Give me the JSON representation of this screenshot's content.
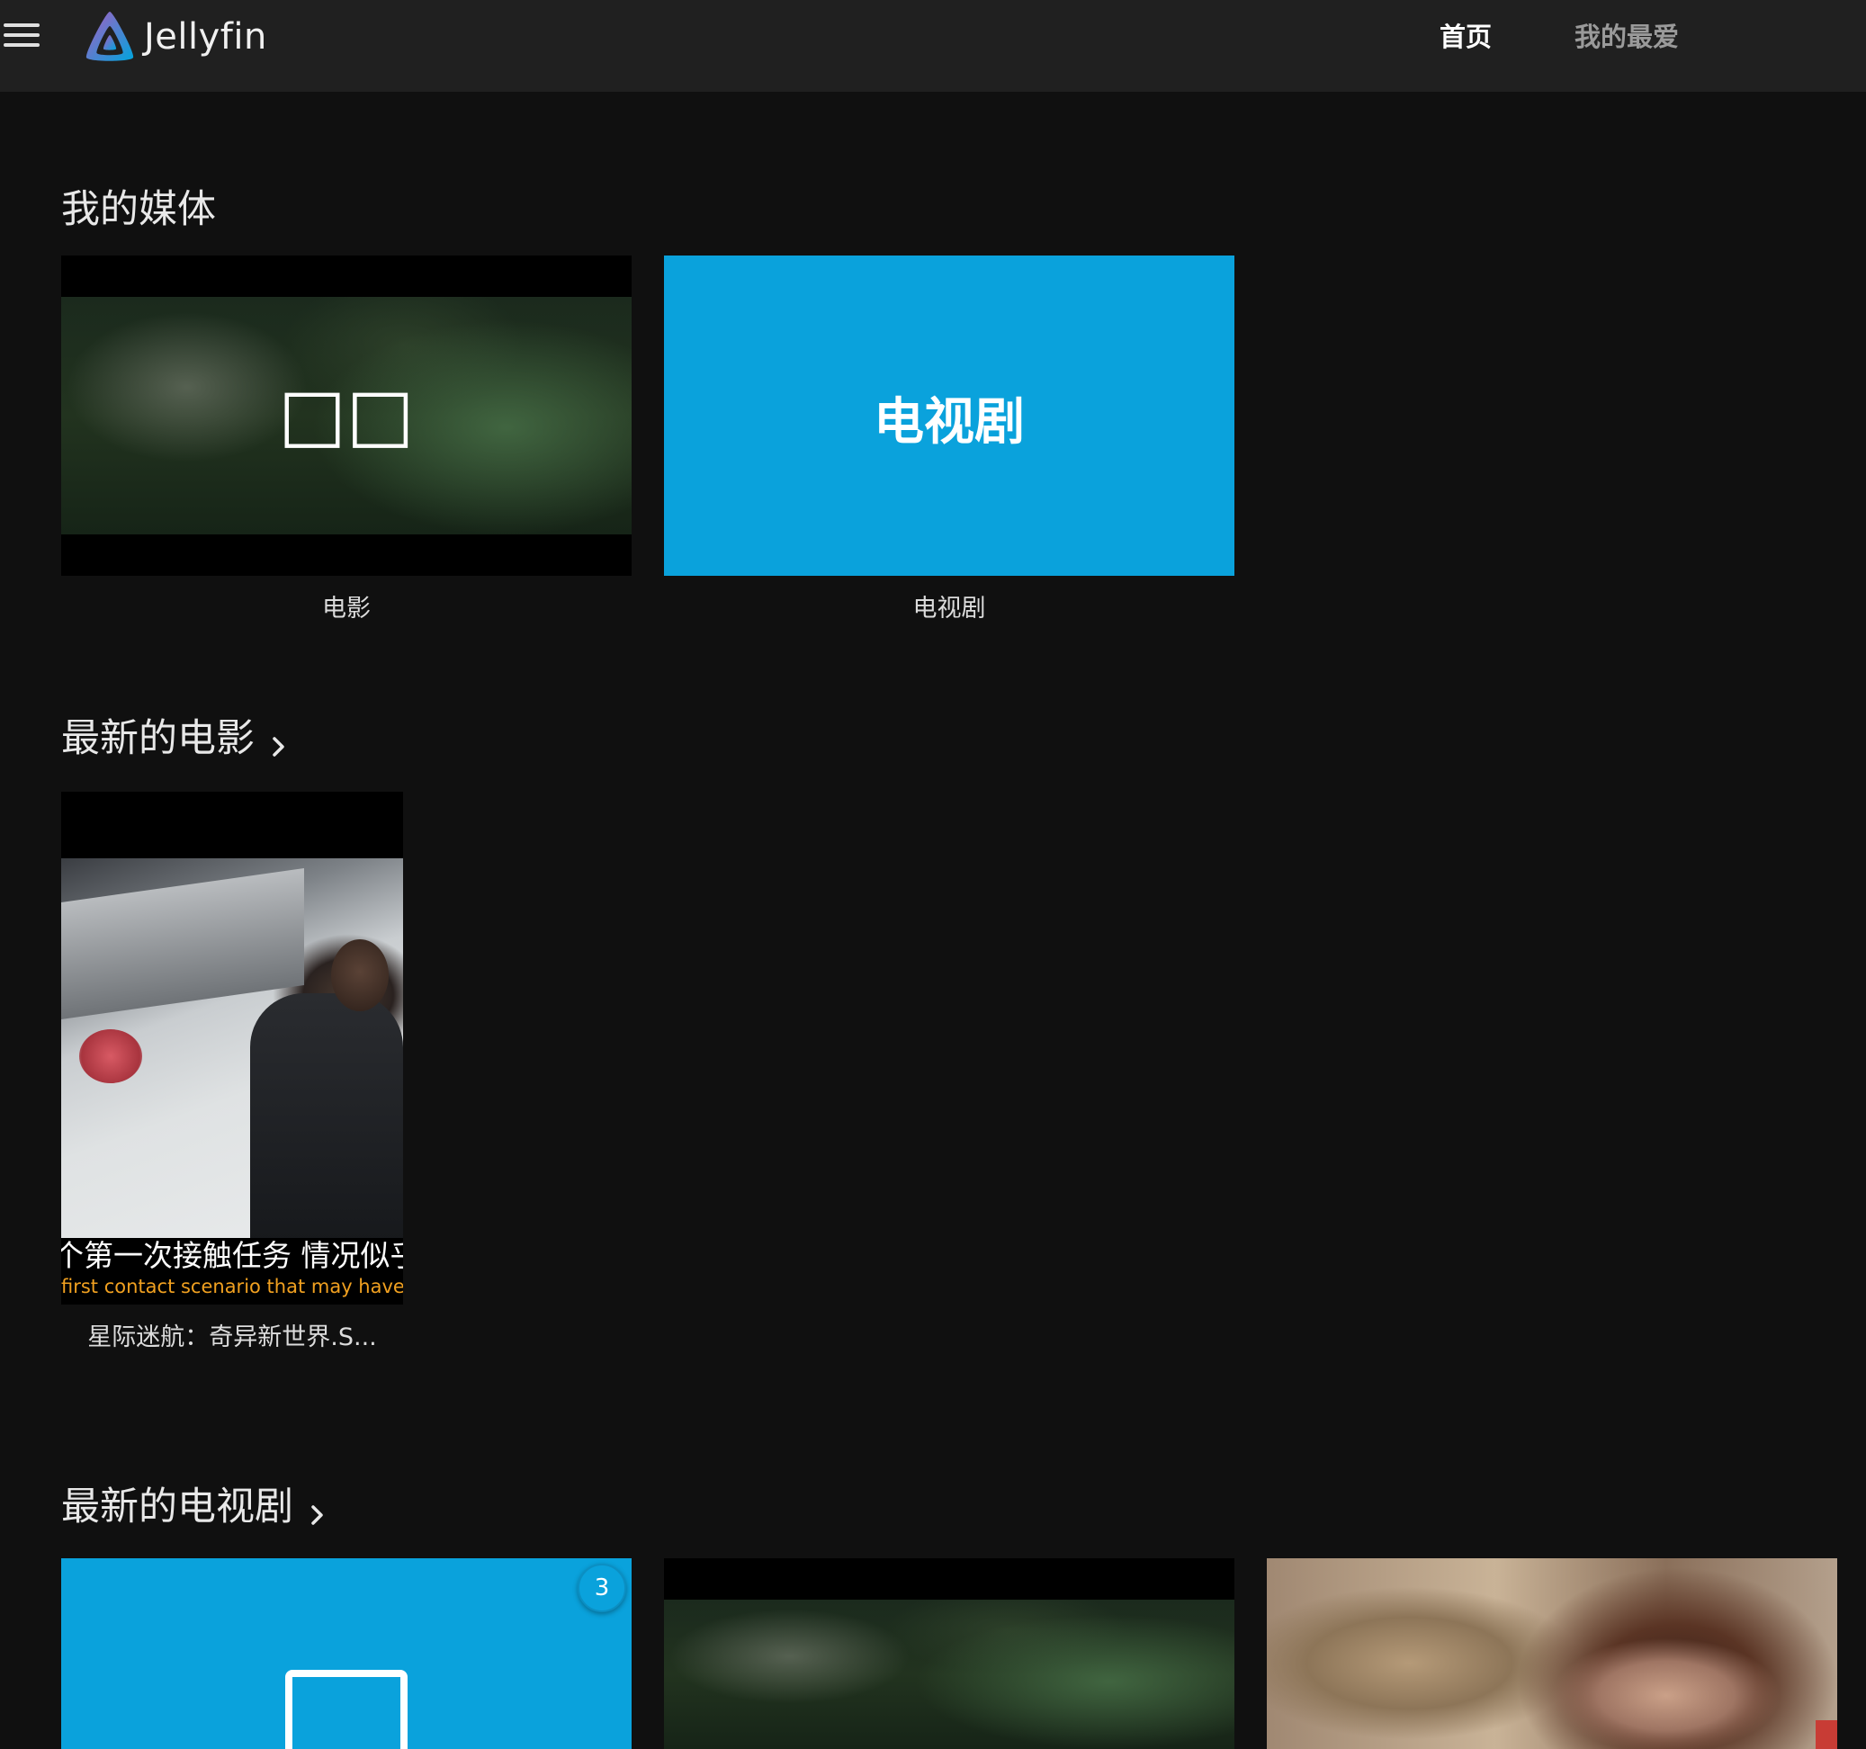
{
  "header": {
    "logo_text": "Jellyfin",
    "tabs": [
      {
        "label": "首页",
        "active": true
      },
      {
        "label": "我的最爱",
        "active": false
      }
    ]
  },
  "sections": {
    "my_media": {
      "title": "我的媒体",
      "items": [
        {
          "label": "电影",
          "overlay_text": "□□"
        },
        {
          "label": "电视剧",
          "overlay_text": "电视剧"
        }
      ]
    },
    "latest_movies": {
      "title": "最新的电影",
      "items": [
        {
          "title": "星际迷航：奇异新世界.S...",
          "subtitle_cn": "个第一次接触任务 情况似乎",
          "subtitle_en": "first contact scenario that may have gone"
        }
      ]
    },
    "latest_tv": {
      "title": "最新的电视剧",
      "items": [
        {
          "badge": "3"
        },
        {},
        {}
      ]
    }
  },
  "colors": {
    "accent": "#0aa2dc",
    "background": "#101010",
    "header": "#202020"
  }
}
